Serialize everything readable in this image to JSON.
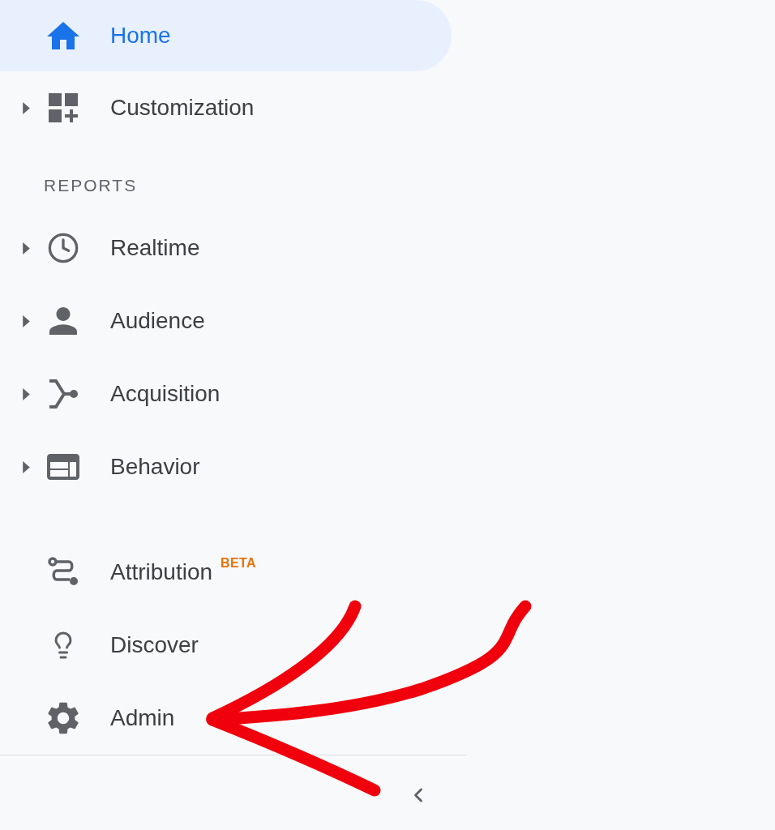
{
  "top_items": [
    {
      "label": "Home",
      "selected": true,
      "expandable": false
    },
    {
      "label": "Customization",
      "selected": false,
      "expandable": true
    }
  ],
  "reports": {
    "heading": "REPORTS",
    "items": [
      {
        "label": "Realtime",
        "selected": false,
        "expandable": true
      },
      {
        "label": "Audience",
        "selected": false,
        "expandable": true
      },
      {
        "label": "Acquisition",
        "selected": false,
        "expandable": true
      },
      {
        "label": "Behavior",
        "selected": false,
        "expandable": true
      }
    ]
  },
  "bottom_items": [
    {
      "label": "Attribution",
      "badge": "BETA",
      "selected": false,
      "expandable": false
    },
    {
      "label": "Discover",
      "selected": false,
      "expandable": false
    },
    {
      "label": "Admin",
      "selected": false,
      "expandable": false
    }
  ]
}
